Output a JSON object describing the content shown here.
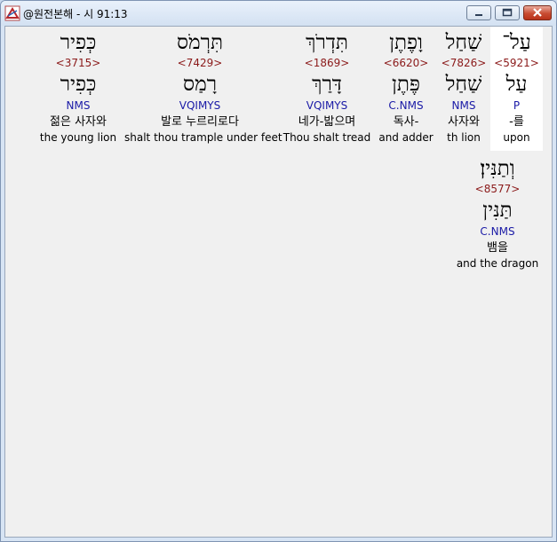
{
  "window": {
    "title": "@원전본해 - 시 91:13",
    "icon": "bible-app-icon"
  },
  "words": [
    {
      "hebrew": "עַל־",
      "strong": "<5921>",
      "lemma": "עַל",
      "parse": "P",
      "korean": "-를",
      "english": "upon",
      "selected": true
    },
    {
      "hebrew": "שַׁחַל",
      "strong": "<7826>",
      "lemma": "שַׁחַל",
      "parse": "NMS",
      "korean": "사자와",
      "english": "th lion"
    },
    {
      "hebrew": "וָפֶתֶן",
      "strong": "<6620>",
      "lemma": "פֶּתֶן",
      "parse": "C.NMS",
      "korean": "독사-",
      "english": "and adder"
    },
    {
      "hebrew": "תִּדְרֹךְ",
      "strong": "<1869>",
      "lemma": "דָּרַךְ",
      "parse": "VQIMYS",
      "korean": "네가-밟으며",
      "english": "Thou shalt tread"
    },
    {
      "hebrew": "תִּרְמֹס",
      "strong": "<7429>",
      "lemma": "רָמַס",
      "parse": "VQIMYS",
      "korean": "발로 누르리로다",
      "english": "shalt thou trample under feet"
    },
    {
      "hebrew": "כְּפִיר",
      "strong": "<3715>",
      "lemma": "כְּפִיר",
      "parse": "NMS",
      "korean": "젊은 사자와",
      "english": "the young lion"
    },
    {
      "hebrew": "וְתַנִּין׃",
      "strong": "<8577>",
      "lemma": "תַּנִּין",
      "parse": "C.NMS",
      "korean": "뱀을",
      "english": "and the dragon"
    }
  ]
}
